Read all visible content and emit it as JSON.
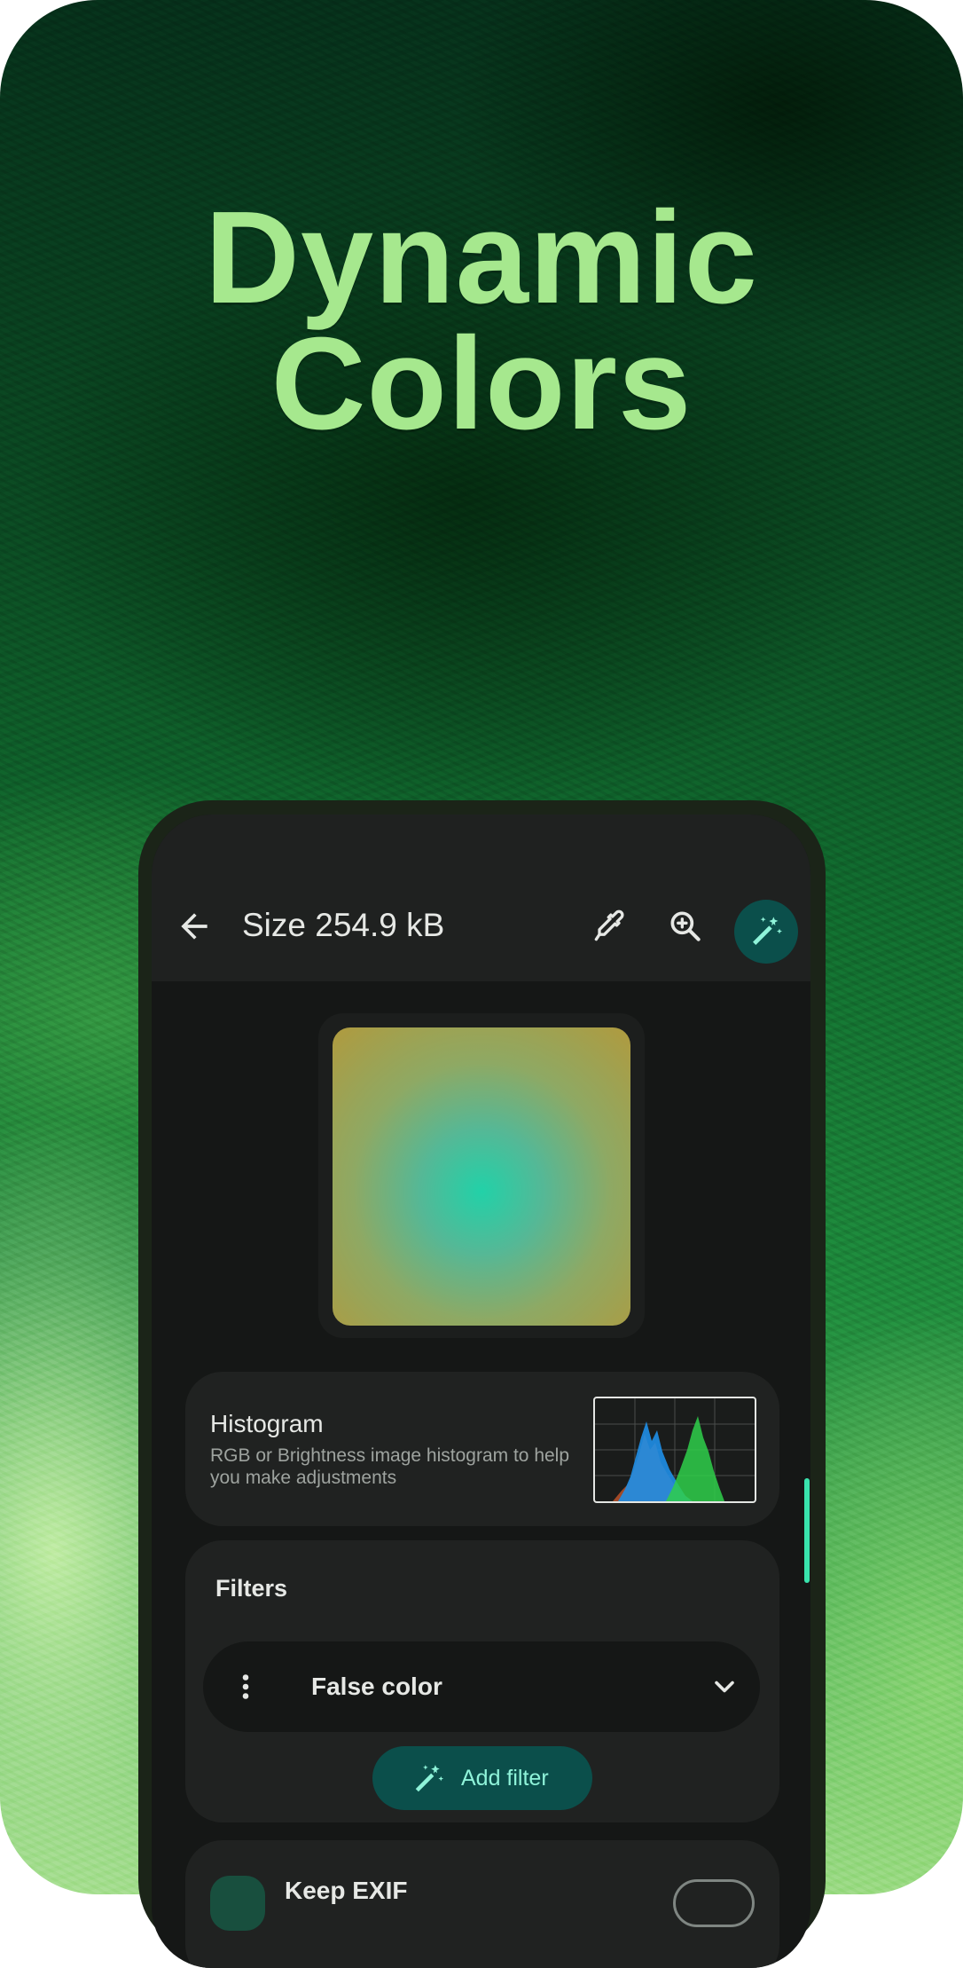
{
  "promo": {
    "headline_line1": "Dynamic",
    "headline_line2": "Colors"
  },
  "toolbar": {
    "title": "Size 254.9 kB",
    "back_icon": "arrow-back-icon",
    "picker_icon": "eyedropper-icon",
    "zoom_icon": "zoom-in-icon",
    "magic_icon": "auto-fix-icon"
  },
  "histogram": {
    "title": "Histogram",
    "subtitle": "RGB or Brightness image histogram to help you make adjustments"
  },
  "filters": {
    "title": "Filters",
    "items": [
      {
        "label": "False color"
      }
    ],
    "add_label": "Add filter"
  },
  "exif": {
    "label": "Keep EXIF"
  },
  "colors": {
    "headline": "#a6e88e",
    "surface": "#1f2120",
    "accent_container": "#0b4f4b",
    "accent_text": "#8ff3d9",
    "scrollbar": "#39e3ad"
  }
}
